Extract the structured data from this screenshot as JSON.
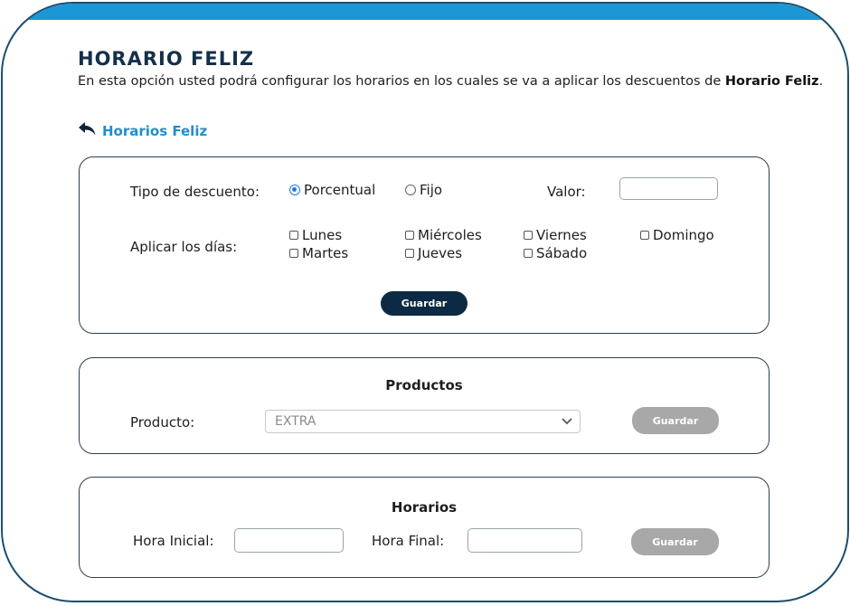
{
  "header": {
    "title": "HORARIO FELIZ",
    "description_prefix": "En esta opción usted podrá configurar los horarios en los cuales se va a aplicar los descuentos de ",
    "description_bold": "Horario Feliz",
    "description_suffix": ".",
    "back_link": "Horarios Feliz"
  },
  "discount": {
    "type_label": "Tipo de descuento:",
    "options": [
      "Porcentual",
      "Fijo"
    ],
    "selected": "Porcentual",
    "value_label": "Valor:",
    "value": "",
    "days_label": "Aplicar los días:",
    "days": [
      "Lunes",
      "Martes",
      "Miércoles",
      "Jueves",
      "Viernes",
      "Sábado",
      "Domingo"
    ],
    "save": "Guardar"
  },
  "products": {
    "heading": "Productos",
    "label": "Producto:",
    "selected": "EXTRA",
    "save": "Guardar"
  },
  "schedule": {
    "heading": "Horarios",
    "start_label": "Hora Inicial:",
    "start_value": "",
    "end_label": "Hora Final:",
    "end_value": "",
    "save": "Guardar"
  },
  "colors": {
    "topbar": "#1c97d6",
    "frame_border": "#1b4f6e",
    "title": "#14304a",
    "link": "#1f8fd0",
    "primary_button": "#0d2a44",
    "disabled_button": "#a8a8a8",
    "radio_selected": "#1f7ae0"
  }
}
